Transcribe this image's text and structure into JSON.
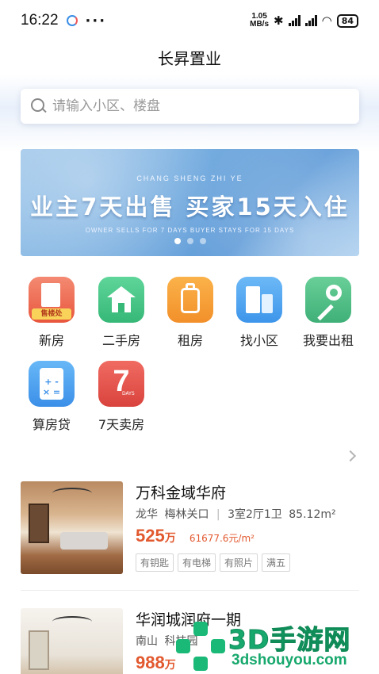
{
  "status_bar": {
    "time": "16:22",
    "dots": "···",
    "net_speed_value": "1.05",
    "net_speed_unit": "MB/s",
    "battery": "84"
  },
  "header": {
    "title": "长昇置业"
  },
  "search": {
    "placeholder": "请输入小区、楼盘"
  },
  "banner": {
    "subtitle": "CHANG SHENG ZHI YE",
    "headline": "业主7天出售 买家15天入住",
    "footnote": "OWNER SELLS FOR 7 DAYS  BUYER STAYS FOR 15 DAYS",
    "slide_count": 3,
    "active_slide": 1
  },
  "menu": {
    "items": [
      {
        "label": "新房",
        "icon": "sales-office-building-icon",
        "badge": "售楼处",
        "color": "#e8563d"
      },
      {
        "label": "二手房",
        "icon": "house-icon",
        "color": "#36b877"
      },
      {
        "label": "租房",
        "icon": "luggage-icon",
        "color": "#f2902a"
      },
      {
        "label": "找小区",
        "icon": "buildings-icon",
        "color": "#3d95ea"
      },
      {
        "label": "我要出租",
        "icon": "key-icon",
        "color": "#3fb078"
      },
      {
        "label": "算房贷",
        "icon": "calculator-icon",
        "calc_symbols": "+ -\n× =",
        "color": "#3b8fe8"
      },
      {
        "label": "7天卖房",
        "icon": "seven-days-icon",
        "glyph": "7",
        "glyph_sub": "DAYS",
        "color": "#d9433d"
      }
    ]
  },
  "listings": [
    {
      "title": "万科金域华府",
      "district": "龙华",
      "area": "梅林关口",
      "layout": "3室2厅1卫",
      "size": "85.12m²",
      "price": "525",
      "price_unit": "万",
      "unit_price": "61677.6元/m²",
      "tags": [
        "有钥匙",
        "有电梯",
        "有照片",
        "满五"
      ]
    },
    {
      "title": "华润城润府一期",
      "district": "南山",
      "area": "科技园",
      "price": "988",
      "price_unit": "万"
    }
  ],
  "watermark": {
    "main": "3D手游网",
    "sub": "3dshouyou.com"
  }
}
